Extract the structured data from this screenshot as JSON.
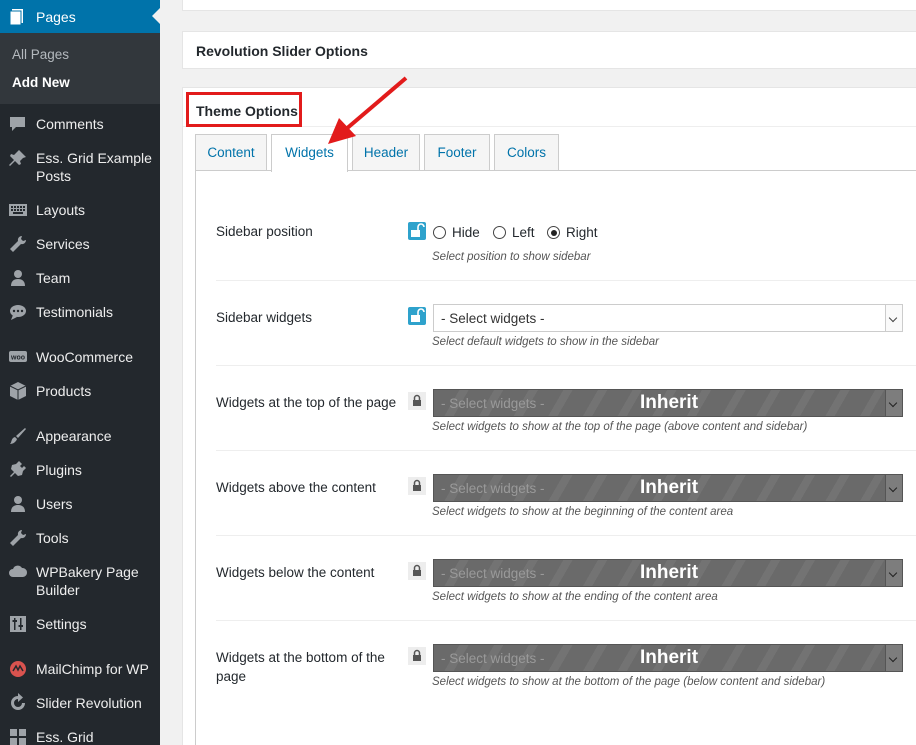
{
  "sidebar": {
    "pages_label": "Pages",
    "submenu": {
      "all_pages": "All Pages",
      "add_new": "Add New"
    },
    "items": [
      {
        "label": "Comments",
        "icon": "comment-icon"
      },
      {
        "label": "Ess. Grid Example Posts",
        "icon": "pin-icon"
      },
      {
        "label": "Layouts",
        "icon": "keyboard-icon"
      },
      {
        "label": "Services",
        "icon": "wrench-icon"
      },
      {
        "label": "Team",
        "icon": "user-icon"
      },
      {
        "label": "Testimonials",
        "icon": "chat-icon"
      },
      {
        "label": "WooCommerce",
        "icon": "woocommerce-icon"
      },
      {
        "label": "Products",
        "icon": "box-icon"
      },
      {
        "label": "Appearance",
        "icon": "brush-icon"
      },
      {
        "label": "Plugins",
        "icon": "plug-icon"
      },
      {
        "label": "Users",
        "icon": "user-icon"
      },
      {
        "label": "Tools",
        "icon": "tools-icon"
      },
      {
        "label": "WPBakery Page Builder",
        "icon": "cloud-icon"
      },
      {
        "label": "Settings",
        "icon": "sliders-icon"
      },
      {
        "label": "MailChimp for WP",
        "icon": "mailchimp-icon"
      },
      {
        "label": "Slider Revolution",
        "icon": "refresh-icon"
      },
      {
        "label": "Ess. Grid",
        "icon": "grid-icon"
      }
    ]
  },
  "main": {
    "revolution_title": "Revolution Slider Options",
    "theme_title": "Theme Options",
    "tabs": [
      {
        "label": "Content",
        "active": false
      },
      {
        "label": "Widgets",
        "active": true
      },
      {
        "label": "Header",
        "active": false
      },
      {
        "label": "Footer",
        "active": false
      },
      {
        "label": "Colors",
        "active": false
      }
    ],
    "rows": {
      "sidebar_position": {
        "label": "Sidebar position",
        "options": [
          "Hide",
          "Left",
          "Right"
        ],
        "selected": "Right",
        "desc": "Select position to show sidebar"
      },
      "sidebar_widgets": {
        "label": "Sidebar widgets",
        "value": "- Select widgets -",
        "desc": "Select default widgets to show in the sidebar"
      },
      "widgets_top": {
        "label": "Widgets at the top of the page",
        "value": "- Select widgets -",
        "overlay": "Inherit",
        "desc": "Select widgets to show at the top of the page (above content and sidebar)"
      },
      "widgets_above": {
        "label": "Widgets above the content",
        "value": "- Select widgets -",
        "overlay": "Inherit",
        "desc": "Select widgets to show at the beginning of the content area"
      },
      "widgets_below": {
        "label": "Widgets below the content",
        "value": "- Select widgets -",
        "overlay": "Inherit",
        "desc": "Select widgets to show at the ending of the content area"
      },
      "widgets_bottom": {
        "label": "Widgets at the bottom of the page",
        "value": "- Select widgets -",
        "overlay": "Inherit",
        "desc": "Select widgets to show at the bottom of the page (below content and sidebar)"
      }
    }
  },
  "colors": {
    "sidebar_bg": "#23282d",
    "active_menu": "#0073aa",
    "link": "#0073aa",
    "annotation": "#e21b1b"
  }
}
